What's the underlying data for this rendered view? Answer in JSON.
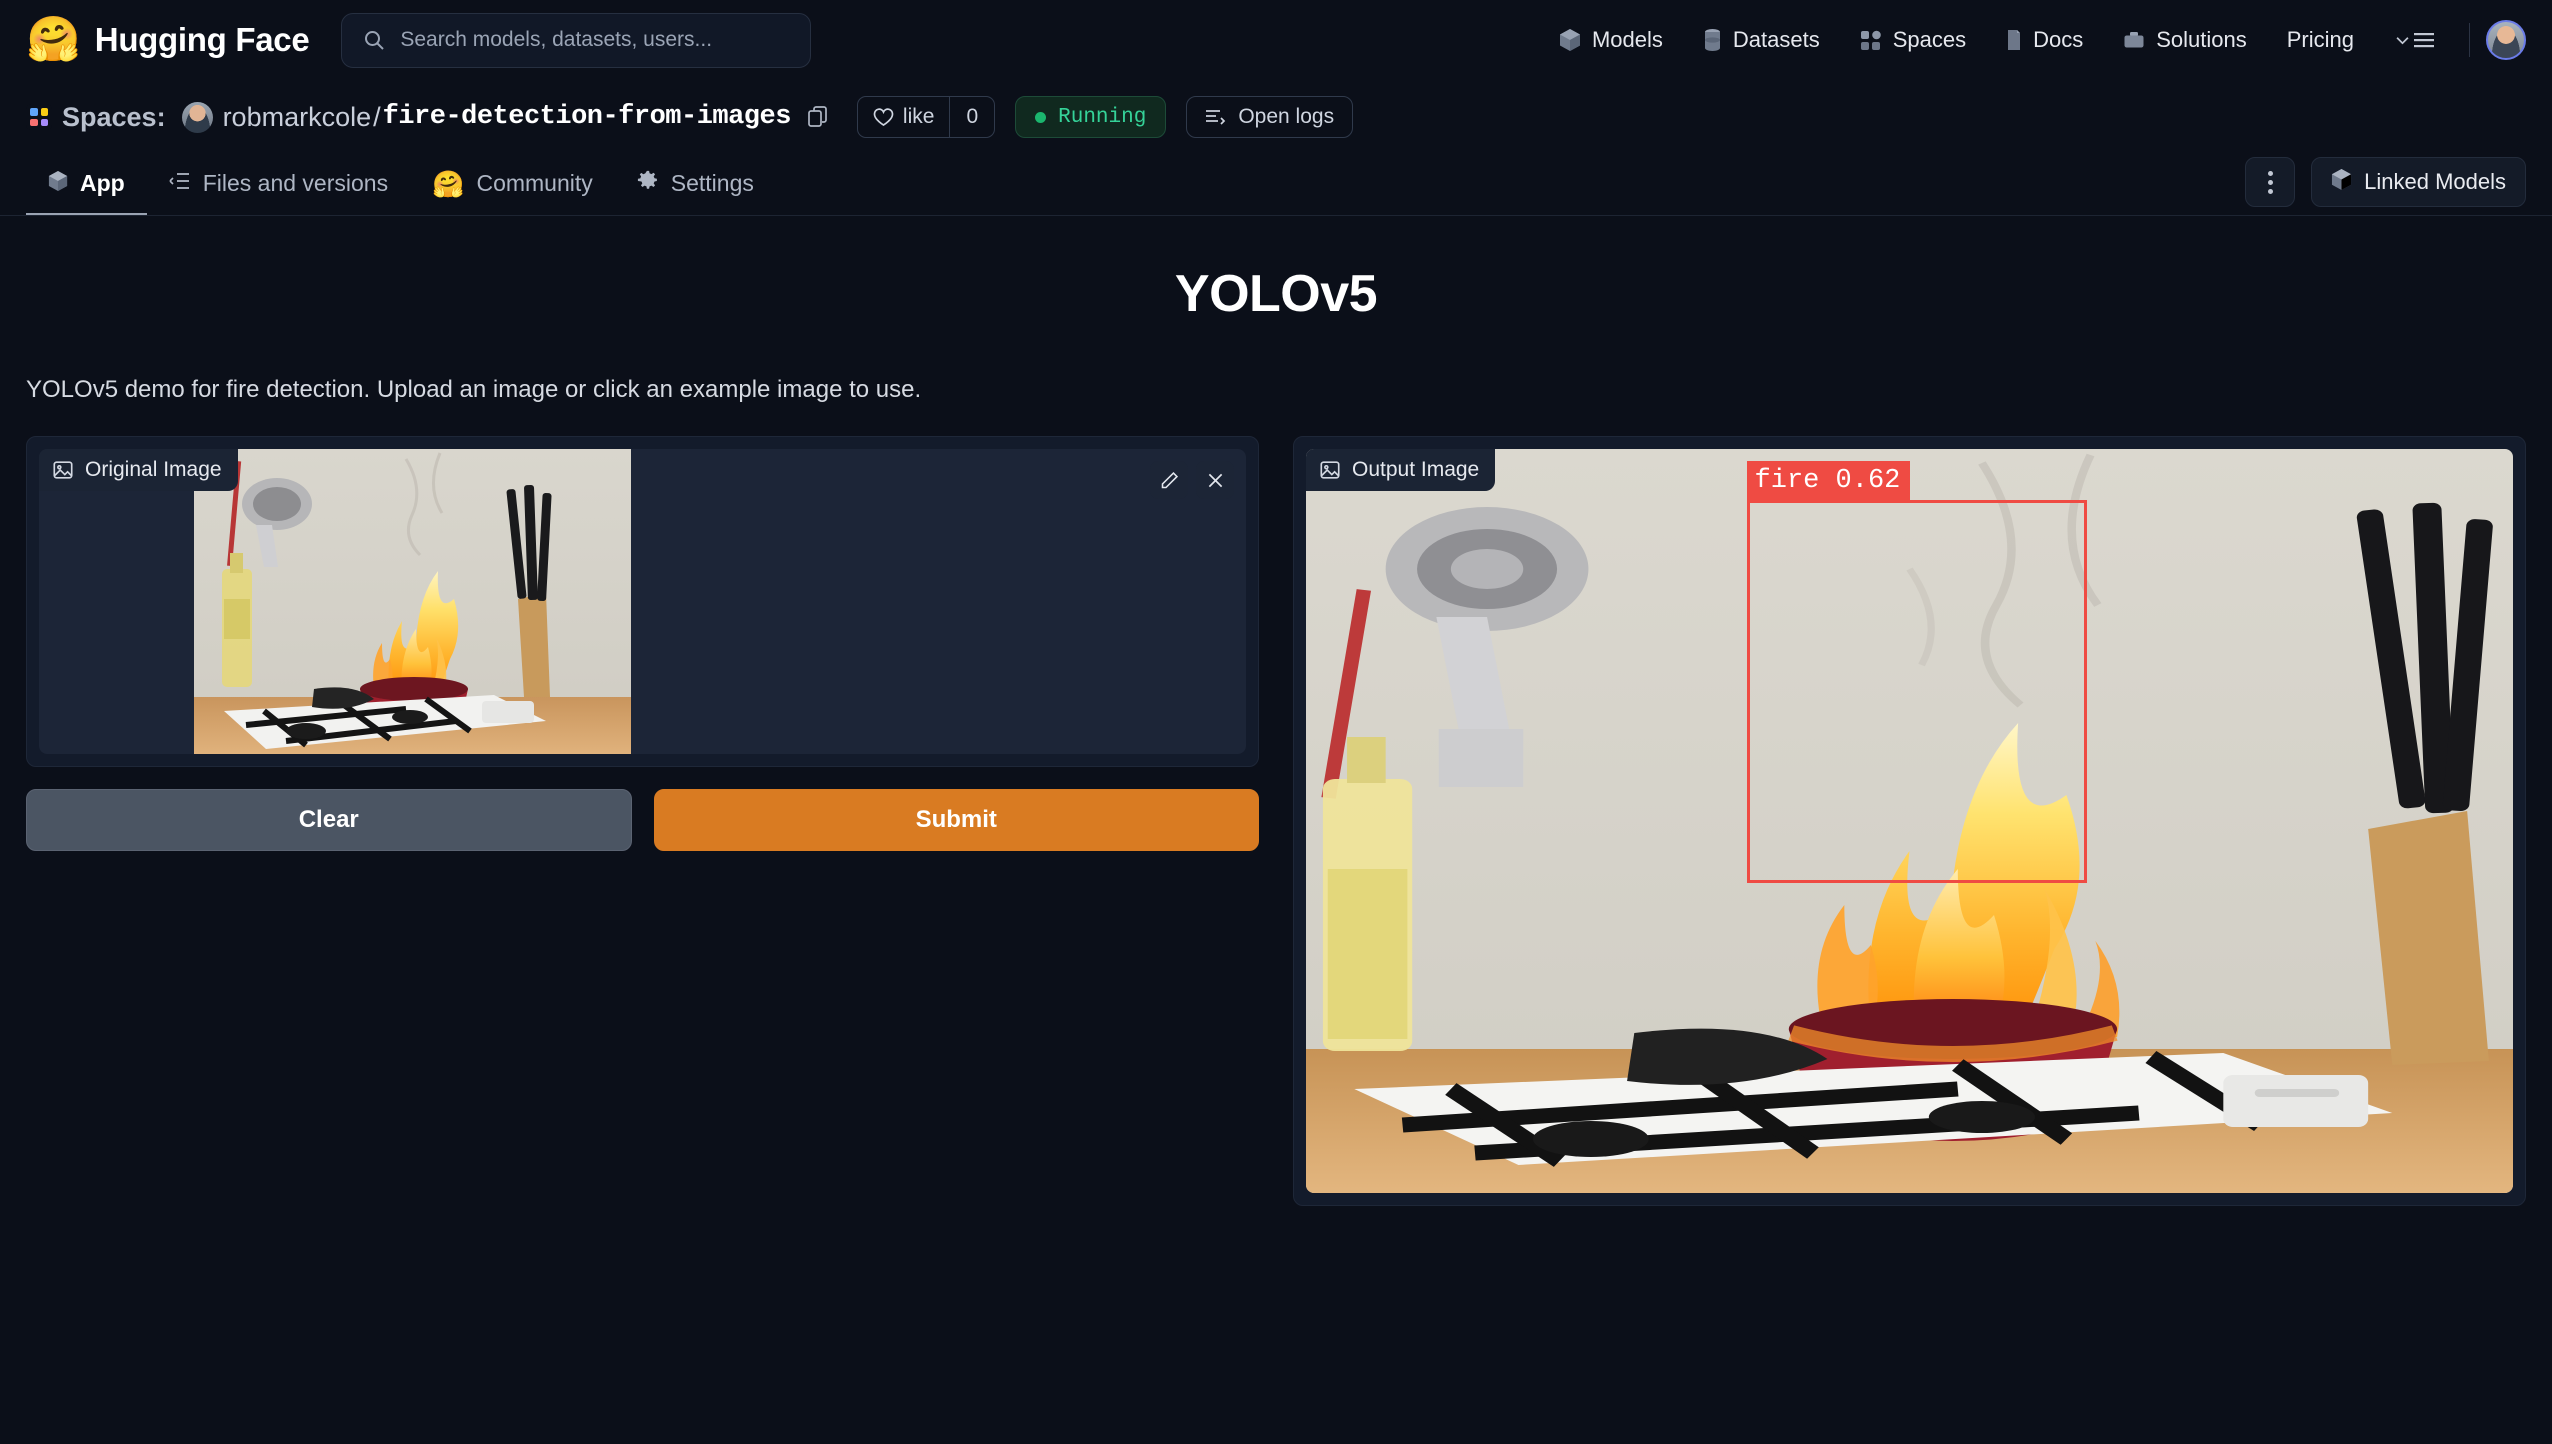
{
  "header": {
    "brand": "Hugging Face",
    "logo_icon": "hugging-face-emoji",
    "search": {
      "placeholder": "Search models, datasets, users...",
      "icon": "search-icon"
    },
    "nav": [
      {
        "label": "Models",
        "icon": "cube-icon"
      },
      {
        "label": "Datasets",
        "icon": "database-icon"
      },
      {
        "label": "Spaces",
        "icon": "grid-icon"
      },
      {
        "label": "Docs",
        "icon": "book-icon"
      },
      {
        "label": "Solutions",
        "icon": "briefcase-icon"
      },
      {
        "label": "Pricing",
        "icon": ""
      }
    ],
    "menu_icon": "chevron-down-hamburger-icon",
    "avatar_icon": "user-avatar"
  },
  "repo": {
    "section_label": "Spaces:",
    "section_icon": "spaces-icon",
    "owner": "robmarkcole",
    "separator": "/",
    "name": "fire-detection-from-images",
    "copy_icon": "copy-icon",
    "like": {
      "label": "like",
      "icon": "heart-icon",
      "count": "0"
    },
    "status": {
      "label": "Running",
      "icon": "status-dot"
    },
    "logs": {
      "label": "Open logs",
      "icon": "logs-icon"
    }
  },
  "tabs": {
    "items": [
      {
        "label": "App",
        "icon": "cube-icon",
        "active": true
      },
      {
        "label": "Files and versions",
        "icon": "files-icon",
        "active": false
      },
      {
        "label": "Community",
        "icon": "hugging-face-emoji",
        "active": false
      },
      {
        "label": "Settings",
        "icon": "gear-icon",
        "active": false
      }
    ],
    "kebab_icon": "kebab-menu-icon",
    "linked_models": {
      "label": "Linked Models",
      "icon": "cube-icon"
    }
  },
  "app": {
    "title": "YOLOv5",
    "description": "YOLOv5 demo for fire detection. Upload an image or click an example image to use.",
    "input_panel": {
      "tag": "Original Image",
      "tag_icon": "image-icon",
      "edit_icon": "pencil-icon",
      "clear_icon": "close-icon"
    },
    "buttons": {
      "clear": "Clear",
      "submit": "Submit"
    },
    "output_panel": {
      "tag": "Output Image",
      "tag_icon": "image-icon",
      "detections": [
        {
          "label": "fire",
          "score": "0.62",
          "text": "fire 0.62"
        }
      ]
    }
  },
  "colors": {
    "page_bg": "#0b0f19",
    "panel_bg": "#131b2b",
    "submit_orange": "#d97b22",
    "clear_gray": "#4b5563",
    "running_green": "#35d399",
    "detection_red": "#ef4b43",
    "avatar_ring": "#6b7ce8"
  }
}
